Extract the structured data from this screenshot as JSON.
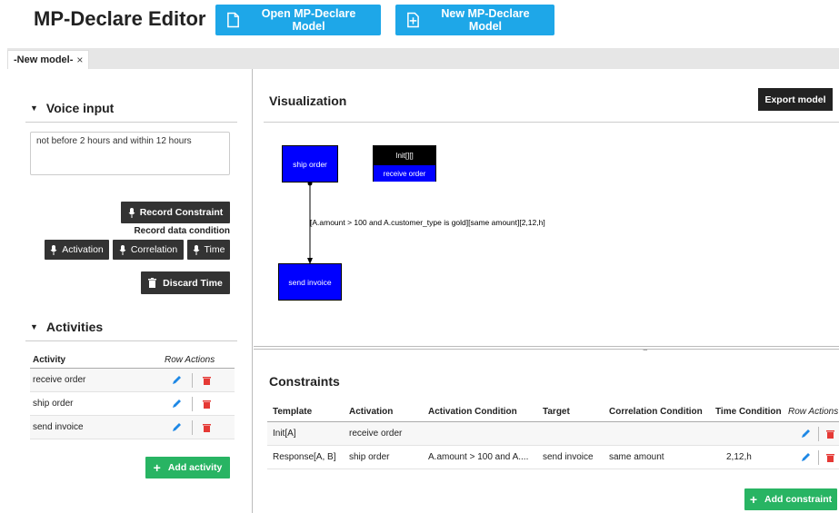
{
  "app": {
    "title": "MP-Declare Editor"
  },
  "header": {
    "open_label": "Open MP-Declare Model",
    "new_label": "New MP-Declare Model"
  },
  "tabs": [
    {
      "label": "-New model-",
      "close": "×"
    }
  ],
  "voice": {
    "title": "Voice input",
    "text": "not before 2 hours and within 12 hours",
    "record_constraint": "Record Constraint",
    "record_data_condition": "Record data condition",
    "activation": "Activation",
    "correlation": "Correlation",
    "time": "Time",
    "discard_time": "Discard Time"
  },
  "activities": {
    "title": "Activities",
    "col_activity": "Activity",
    "col_actions": "Row Actions",
    "rows": [
      {
        "name": "receive order"
      },
      {
        "name": "ship order"
      },
      {
        "name": "send invoice"
      }
    ],
    "add_label": "Add activity"
  },
  "visualization": {
    "title": "Visualization",
    "export_label": "Export model",
    "nodes": {
      "ship": "ship order",
      "init_top": "Init[][]",
      "init_bottom": "receive order",
      "invoice": "send invoice"
    },
    "edge_label": "[A.amount > 100 and A.customer_type is gold][same amount][2,12,h]",
    "grip": "....."
  },
  "constraints": {
    "title": "Constraints",
    "headers": [
      "Template",
      "Activation",
      "Activation Condition",
      "Target",
      "Correlation Condition",
      "Time Condition",
      "Row Actions"
    ],
    "rows": [
      {
        "template": "Init[A]",
        "activation": "receive order",
        "activation_condition": "",
        "target": "",
        "correlation_condition": "",
        "time_condition": ""
      },
      {
        "template": "Response[A, B]",
        "activation": "ship order",
        "activation_condition": "A.amount > 100 and A....",
        "target": "send invoice",
        "correlation_condition": "same amount",
        "time_condition": "2,12,h"
      }
    ],
    "add_label": "Add constraint"
  },
  "colors": {
    "accent": "#1ea7e8",
    "node": "#0000ff",
    "green": "#28b463",
    "dark": "#333333",
    "pencil": "#1e88e5",
    "trash": "#e53935"
  }
}
